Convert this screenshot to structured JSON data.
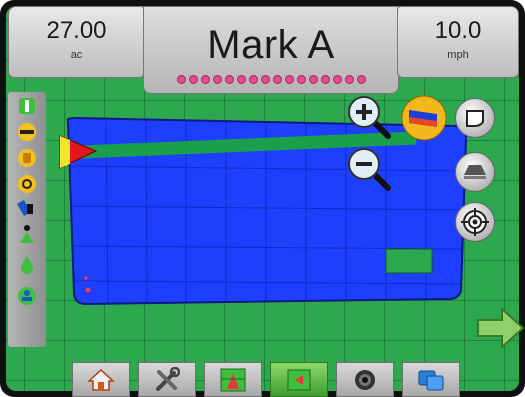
{
  "header": {
    "area_value": "27.00",
    "area_unit": "ac",
    "title": "Mark A",
    "speed_value": "10.0",
    "speed_unit": "mph",
    "boom_section_count": 16
  },
  "side_toolbar": {
    "icons": [
      "section-guide-icon",
      "boom-icon",
      "hand-stop-icon",
      "hazard-icon",
      "flow-icon",
      "vehicle-icon",
      "droplet-icon",
      "marker-icon"
    ]
  },
  "map_controls": {
    "zoom_in": "zoom-in-icon",
    "zoom_out": "zoom-out-icon",
    "coverage": "coverage-map-icon",
    "boundary": "boundary-icon",
    "view_perspective": "perspective-icon",
    "target": "target-icon",
    "next": "arrow-right-icon"
  },
  "bottom_tabs": [
    {
      "icon": "home-icon",
      "active": false
    },
    {
      "icon": "tools-icon",
      "active": false
    },
    {
      "icon": "field-guidance-icon",
      "active": false
    },
    {
      "icon": "map-marker-flag-icon",
      "active": true
    },
    {
      "icon": "camera-icon",
      "active": false
    },
    {
      "icon": "windows-icon",
      "active": false
    }
  ],
  "colors": {
    "field": "#2ea84f",
    "coverage": "#1f3fff",
    "guidance_line": "#1aa04a",
    "boom_light": "#e84a8a",
    "active_tab": "#5dbb43"
  }
}
